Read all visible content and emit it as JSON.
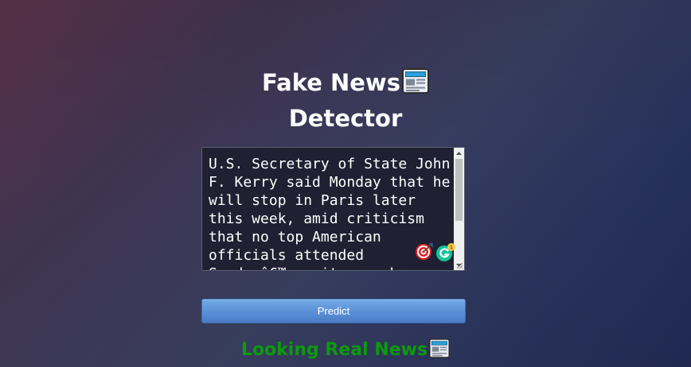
{
  "app": {
    "title_line1": "Fake News",
    "title_line2": "Detector",
    "title_icon": "newspaper-icon"
  },
  "input": {
    "text": "U.S. Secretary of State John F. Kerry said Monday that he will stop in Paris later this week, amid criticism that no top American officials attended Sundayâ€™s unity march"
  },
  "extensions": {
    "target_icon": "target-icon",
    "grammarly_icon": "grammarly-icon",
    "grammarly_badge": "1"
  },
  "actions": {
    "predict_label": "Predict"
  },
  "result": {
    "text": "Looking Real News",
    "icon": "newspaper-icon",
    "color": "#0d9a0d"
  },
  "colors": {
    "button": "#5a8fd6",
    "textarea_bg": "#1f2132",
    "title": "#ffffff"
  }
}
